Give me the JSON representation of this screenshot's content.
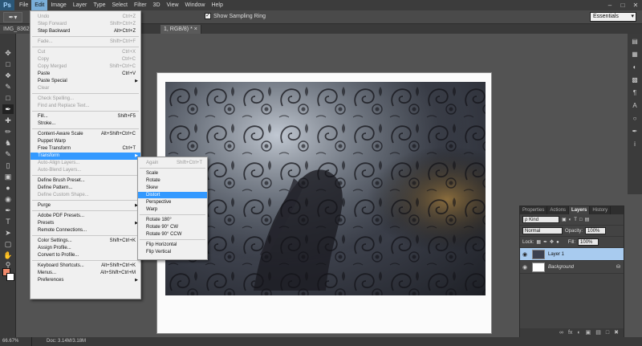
{
  "app": {
    "logo": "Ps"
  },
  "menubar": {
    "items": [
      "File",
      "Edit",
      "Image",
      "Layer",
      "Type",
      "Select",
      "Filter",
      "3D",
      "View",
      "Window",
      "Help"
    ],
    "window_controls": [
      "–",
      "□",
      "✕"
    ]
  },
  "options": {
    "tool_icon": "✒▾",
    "show_sampling_ring": "Show Sampling Ring",
    "sampling_checked": "✓",
    "workspace": "Essentials"
  },
  "doc_tabs": {
    "left": "IMG_8362.jp",
    "right": "1, RGB/8) *",
    "close": "×"
  },
  "edit_menu": {
    "items": [
      {
        "label": "Undo",
        "shortcut": "Ctrl+Z",
        "disabled": true
      },
      {
        "label": "Step Forward",
        "shortcut": "Shift+Ctrl+Z",
        "disabled": true
      },
      {
        "label": "Step Backward",
        "shortcut": "Alt+Ctrl+Z"
      },
      {
        "label": "Fade...",
        "shortcut": "Shift+Ctrl+F",
        "disabled": true
      },
      {
        "label": "Cut",
        "shortcut": "Ctrl+X",
        "disabled": true
      },
      {
        "label": "Copy",
        "shortcut": "Ctrl+C",
        "disabled": true
      },
      {
        "label": "Copy Merged",
        "shortcut": "Shift+Ctrl+C",
        "disabled": true
      },
      {
        "label": "Paste",
        "shortcut": "Ctrl+V"
      },
      {
        "label": "Paste Special",
        "submenu": true
      },
      {
        "label": "Clear",
        "disabled": true
      },
      {
        "label": "Check Spelling...",
        "disabled": true
      },
      {
        "label": "Find and Replace Text...",
        "disabled": true
      },
      {
        "label": "Fill...",
        "shortcut": "Shift+F5"
      },
      {
        "label": "Stroke..."
      },
      {
        "label": "Content-Aware Scale",
        "shortcut": "Alt+Shift+Ctrl+C"
      },
      {
        "label": "Puppet Warp"
      },
      {
        "label": "Free Transform",
        "shortcut": "Ctrl+T"
      },
      {
        "label": "Transform",
        "submenu": true,
        "highlight": true
      },
      {
        "label": "Auto-Align Layers...",
        "disabled": true
      },
      {
        "label": "Auto-Blend Layers...",
        "disabled": true
      },
      {
        "label": "Define Brush Preset..."
      },
      {
        "label": "Define Pattern..."
      },
      {
        "label": "Define Custom Shape...",
        "disabled": true
      },
      {
        "label": "Purge",
        "submenu": true
      },
      {
        "label": "Adobe PDF Presets..."
      },
      {
        "label": "Presets",
        "submenu": true
      },
      {
        "label": "Remote Connections..."
      },
      {
        "label": "Color Settings...",
        "shortcut": "Shift+Ctrl+K"
      },
      {
        "label": "Assign Profile..."
      },
      {
        "label": "Convert to Profile..."
      },
      {
        "label": "Keyboard Shortcuts...",
        "shortcut": "Alt+Shift+Ctrl+K"
      },
      {
        "label": "Menus...",
        "shortcut": "Alt+Shift+Ctrl+M"
      },
      {
        "label": "Preferences",
        "submenu": true
      }
    ],
    "submenu_arrow": "▶"
  },
  "transform_menu": {
    "items": [
      {
        "label": "Again",
        "shortcut": "Shift+Ctrl+T",
        "disabled": true
      },
      {
        "label": "Scale"
      },
      {
        "label": "Rotate"
      },
      {
        "label": "Skew"
      },
      {
        "label": "Distort",
        "highlight": true
      },
      {
        "label": "Perspective"
      },
      {
        "label": "Warp"
      },
      {
        "label": "Rotate 180°"
      },
      {
        "label": "Rotate 90° CW"
      },
      {
        "label": "Rotate 90° CCW"
      },
      {
        "label": "Flip Horizontal"
      },
      {
        "label": "Flip Vertical"
      }
    ]
  },
  "layers_panel": {
    "tabs": [
      "Properties",
      "Actions",
      "Layers",
      "History"
    ],
    "active_tab": "Layers",
    "kind_filter": "ρ Kind",
    "blend_mode": "Normal",
    "opacity_label": "Opacity:",
    "opacity_value": "100%",
    "lock_label": "Lock:",
    "fill_label": "Fill:",
    "fill_value": "100%",
    "layers": [
      {
        "name": "Layer 1",
        "selected": true
      },
      {
        "name": "Background",
        "selected": false
      }
    ],
    "eye_glyph": "◉",
    "footer_icons": [
      "∞",
      "fx",
      "◐",
      "▣",
      "▤",
      "□",
      "✖"
    ]
  },
  "status": {
    "zoom": "66.67%",
    "doc": "Doc: 3.14M/3.18M"
  }
}
